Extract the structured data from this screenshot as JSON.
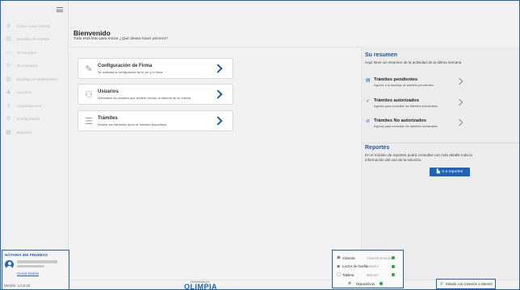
{
  "window": {
    "minimize": "—",
    "maximize": "☐",
    "close": "✕"
  },
  "sidebar": {
    "items": [
      {
        "icon": "gear-icon",
        "glyph": "⚙",
        "label": "Iniciar nuevo trámite"
      },
      {
        "icon": "inbox-icon",
        "glyph": "▤",
        "label": "Bandeja de entrada"
      },
      {
        "icon": "document-icon",
        "glyph": "▭",
        "label": "Terminados"
      },
      {
        "icon": "rejected-icon",
        "glyph": "⊘",
        "label": "Rechazados"
      },
      {
        "icon": "tray-icon",
        "glyph": "▥",
        "label": "Bandeja de Multitrámites"
      },
      {
        "icon": "users-icon",
        "glyph": "♟",
        "label": "Usuarios"
      },
      {
        "icon": "key-icon",
        "glyph": "⚷",
        "label": "Autorizaciones"
      },
      {
        "icon": "settings-icon",
        "glyph": "⚙",
        "label": "Configuración"
      },
      {
        "icon": "reports-icon",
        "glyph": "▦",
        "label": "Reportes"
      }
    ]
  },
  "user": {
    "title": "NOTARIA 360 PRUEBAS",
    "logout": "Cerrar Sesión"
  },
  "version": "Versión: 1.0.0.22",
  "main": {
    "title": "Bienvenido",
    "subtitle": "Todo está listo para iniciar ¿Qué desea hacer primero?",
    "cards": [
      {
        "icon": "signature-icon",
        "glyph": "✎",
        "title": "Configuración de Firma",
        "desc": "Se realizará la configuración de tu pin y tu firma."
      },
      {
        "icon": "users-icon",
        "glyph": "⚇",
        "title": "Usuarios",
        "desc": "Administre los usuarios que tendrán acceso al sistema de su notaría"
      },
      {
        "icon": "procedures-icon",
        "glyph": "☰",
        "title": "Trámites",
        "desc": "Realice los diferentes tipos de trámites disponibles"
      }
    ]
  },
  "summary": {
    "title": "Su resumen",
    "desc": "Aquí tiene un resumen de la actividad de la última semana",
    "items": [
      {
        "icon": "pending-icon",
        "glyph": "▤",
        "label": "Trámites pendientes",
        "sub": "Ingrese a la bandeja de trámites pendientes"
      },
      {
        "icon": "authorized-icon",
        "glyph": "✓",
        "label": "Trámites autorizados",
        "sub": "Ingresa para consultar los trámites autorizados"
      },
      {
        "icon": "not-authorized-icon",
        "glyph": "⊘",
        "label": "Trámites No autorizados",
        "sub": "Ingresa para consultar los trámites rechazados"
      }
    ],
    "reports_title": "Reportes",
    "reports_desc": "En el módulo de reportes podrá consultar con más detalle toda la información del uso de la solución.",
    "reports_button": "Ir a reportes",
    "reports_button_glyph": "▙"
  },
  "devices": {
    "rows": [
      {
        "icon": "camera-icon",
        "glyph": "▣",
        "name": "Cámara",
        "status": "Cámara principal"
      },
      {
        "icon": "fingerprint-icon",
        "glyph": "◉",
        "name": "Lector de huella",
        "status": "Morpho"
      },
      {
        "icon": "tablet-icon",
        "glyph": "▢",
        "name": "Tableta",
        "status": "Wacom"
      }
    ],
    "footer_glyph": "⚙",
    "footer": "Dispositivos"
  },
  "brand": {
    "small": "Desarrollado por",
    "logo": "OLIMPIA"
  },
  "connection": {
    "glyph": "✆",
    "text": "Estado con conexión a internet"
  },
  "colors": {
    "accent": "#1f63b8",
    "ok": "#26a531"
  }
}
